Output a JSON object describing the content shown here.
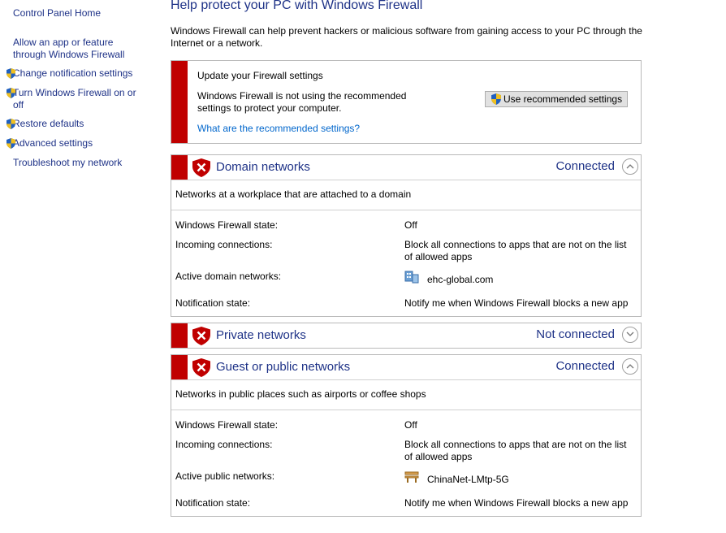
{
  "sidebar": {
    "home": "Control Panel Home",
    "items": [
      {
        "label": "Allow an app or feature through Windows Firewall",
        "shield": false
      },
      {
        "label": "Change notification settings",
        "shield": true
      },
      {
        "label": "Turn Windows Firewall on or off",
        "shield": true
      },
      {
        "label": "Restore defaults",
        "shield": true
      },
      {
        "label": "Advanced settings",
        "shield": true
      },
      {
        "label": "Troubleshoot my network",
        "shield": false
      }
    ]
  },
  "main": {
    "title": "Help protect your PC with Windows Firewall",
    "intro": "Windows Firewall can help prevent hackers or malicious software from gaining access to your PC through the Internet or a network.",
    "update": {
      "heading": "Update your Firewall settings",
      "text": "Windows Firewall is not using the recommended settings to protect your computer.",
      "link": "What are the recommended settings?",
      "button": "Use recommended settings"
    },
    "networks": {
      "domain": {
        "name": "Domain networks",
        "status": "Connected",
        "description": "Networks at a workplace that are attached to a domain",
        "state_label": "Windows Firewall state:",
        "state_value": "Off",
        "incoming_label": "Incoming connections:",
        "incoming_value": "Block all connections to apps that are not on the list of allowed apps",
        "active_label": "Active domain networks:",
        "active_value": "ehc-global.com",
        "notify_label": "Notification state:",
        "notify_value": "Notify me when Windows Firewall blocks a new app"
      },
      "private": {
        "name": "Private networks",
        "status": "Not connected"
      },
      "public": {
        "name": "Guest or public networks",
        "status": "Connected",
        "description": "Networks in public places such as airports or coffee shops",
        "state_label": "Windows Firewall state:",
        "state_value": "Off",
        "incoming_label": "Incoming connections:",
        "incoming_value": "Block all connections to apps that are not on the list of allowed apps",
        "active_label": "Active public networks:",
        "active_value": "ChinaNet-LMtp-5G",
        "notify_label": "Notification state:",
        "notify_value": "Notify me when Windows Firewall blocks a new app"
      }
    }
  },
  "colors": {
    "accent": "#1e3287",
    "warning_bar": "#c00000",
    "link": "#0066cc"
  }
}
